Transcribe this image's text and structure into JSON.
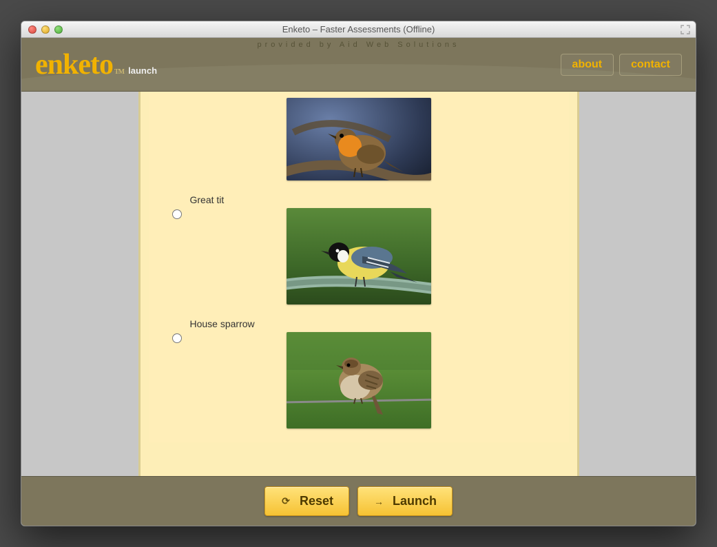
{
  "window": {
    "title": "Enketo – Faster Assessments (Offline)"
  },
  "banner": {
    "provided_by": "provided by Aid Web Solutions",
    "brand": "enketo",
    "brand_tm": "TM",
    "brand_sub": "launch",
    "nav": {
      "about": "about",
      "contact": "contact"
    }
  },
  "form": {
    "options": [
      {
        "key": "robin",
        "label": "",
        "has_label": false
      },
      {
        "key": "tit",
        "label": "Great tit",
        "has_label": true
      },
      {
        "key": "sparrow",
        "label": "House sparrow",
        "has_label": true
      }
    ]
  },
  "footer": {
    "reset_label": "Reset",
    "launch_label": "Launch"
  }
}
